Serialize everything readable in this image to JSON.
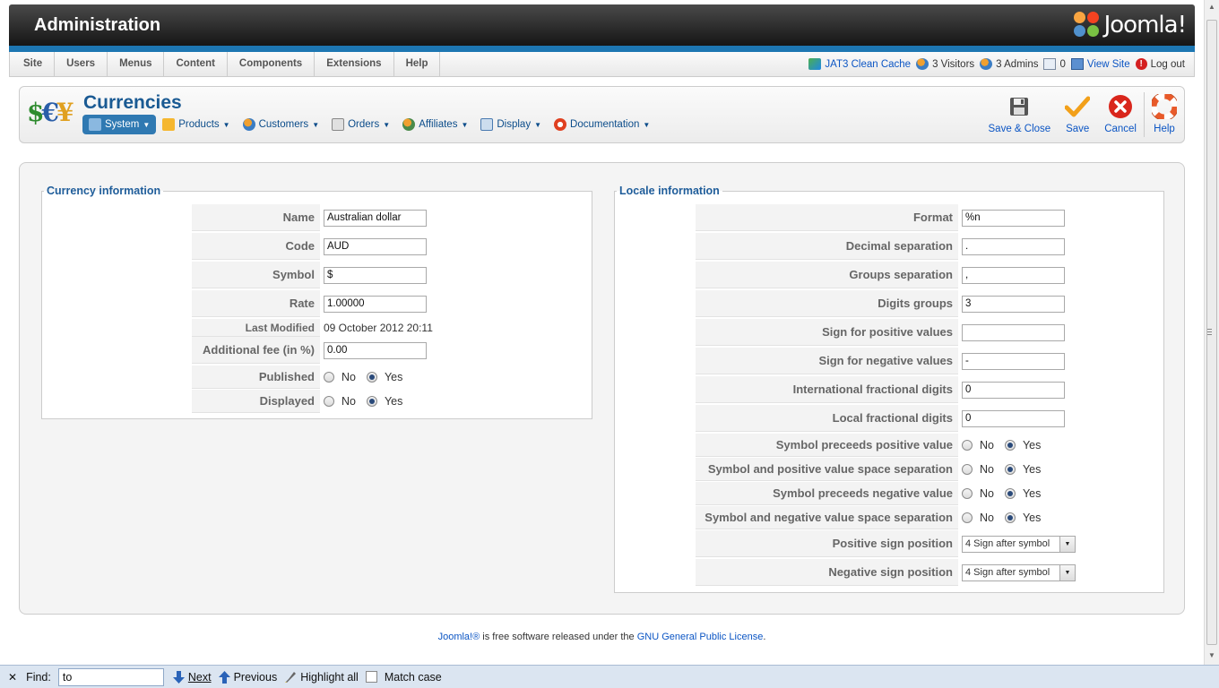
{
  "header": {
    "title": "Administration",
    "logo_text": "Joomla!"
  },
  "menu": [
    "Site",
    "Users",
    "Menus",
    "Content",
    "Components",
    "Extensions",
    "Help"
  ],
  "status": {
    "cache": "JAT3 Clean Cache",
    "visitors": "3 Visitors",
    "admins": "3 Admins",
    "messages": "0",
    "view_site": "View Site",
    "logout": "Log out"
  },
  "page": {
    "title": "Currencies"
  },
  "submenu": [
    "System",
    "Products",
    "Customers",
    "Orders",
    "Affiliates",
    "Display",
    "Documentation"
  ],
  "toolbar": {
    "save_close": "Save & Close",
    "save": "Save",
    "cancel": "Cancel",
    "help": "Help"
  },
  "currency": {
    "legend": "Currency information",
    "name_label": "Name",
    "name": "Australian dollar",
    "code_label": "Code",
    "code": "AUD",
    "symbol_label": "Symbol",
    "symbol": "$",
    "rate_label": "Rate",
    "rate": "1.00000",
    "modified_label": "Last Modified",
    "modified": "09 October 2012 20:11",
    "fee_label": "Additional fee (in %)",
    "fee": "0.00",
    "published_label": "Published",
    "displayed_label": "Displayed"
  },
  "radio": {
    "no": "No",
    "yes": "Yes"
  },
  "locale": {
    "legend": "Locale information",
    "format_label": "Format",
    "format": "%n",
    "decimal_label": "Decimal separation",
    "decimal": ".",
    "groups_label": "Groups separation",
    "groups": ",",
    "digits_label": "Digits groups",
    "digits": "3",
    "pos_sign_label": "Sign for positive values",
    "pos_sign": "",
    "neg_sign_label": "Sign for negative values",
    "neg_sign": "-",
    "intl_frac_label": "International fractional digits",
    "intl_frac": "0",
    "local_frac_label": "Local fractional digits",
    "local_frac": "0",
    "sym_pos_label": "Symbol preceeds positive value",
    "sym_pos_space_label": "Symbol and positive value space separation",
    "sym_neg_label": "Symbol preceeds negative value",
    "sym_neg_space_label": "Symbol and negative value space separation",
    "pos_pos_label": "Positive sign position",
    "pos_pos": "4 Sign after symbol",
    "neg_pos_label": "Negative sign position",
    "neg_pos": "4 Sign after symbol"
  },
  "footer": {
    "joomla": "Joomla!®",
    "text": " is free software released under the ",
    "license": "GNU General Public License",
    "end": "."
  },
  "findbar": {
    "label": "Find:",
    "value": "to",
    "next": "Next",
    "previous": "Previous",
    "highlight": "Highlight all",
    "match": "Match case"
  }
}
